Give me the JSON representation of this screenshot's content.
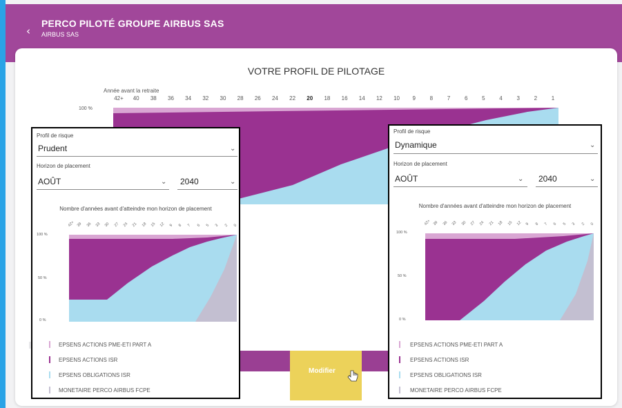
{
  "header": {
    "back_glyph": "‹",
    "title": "PERCO PILOTÉ GROUPE AIRBUS SAS",
    "subtitle": "AIRBUS SAS"
  },
  "card": {
    "title": "VOTRE PROFIL DE PILOTAGE",
    "axis_label": "Année avant la retraite",
    "ticks": [
      "42+",
      "40",
      "38",
      "36",
      "34",
      "32",
      "30",
      "28",
      "26",
      "24",
      "22",
      "20",
      "18",
      "16",
      "14",
      "12",
      "10",
      "9",
      "8",
      "7",
      "6",
      "5",
      "4",
      "3",
      "2",
      "1"
    ],
    "highlighted_tick": "20",
    "y_label_100": "100 %"
  },
  "colors": {
    "header": "#a1479a",
    "pme_eti": "#d9a6d3",
    "actions_isr": "#9a3291",
    "obligations_isr": "#a9dcef",
    "monetaire": "#c3bfd1",
    "highlight": "#ecd25a"
  },
  "modify_button": {
    "label": "Modifier"
  },
  "panels": [
    {
      "risk_label": "Profil de risque",
      "risk_value": "Prudent",
      "horizon_label": "Horizon de placement",
      "month_value": "AOÛT",
      "year_value": "2040",
      "chart_title": "Nombre d'années avant d'atteindre mon horizon de placement",
      "y_labels": [
        "100 %",
        "50 %",
        "0 %"
      ],
      "x_ticks": [
        "42+",
        "39",
        "36",
        "33",
        "30",
        "27",
        "24",
        "21",
        "18",
        "15",
        "12",
        "9",
        "8",
        "7",
        "6",
        "5",
        "3",
        "2",
        "0"
      ],
      "legend": [
        {
          "label": "EPSENS ACTIONS PME-ETI PART A",
          "color": "#d9a6d3"
        },
        {
          "label": "EPSENS ACTIONS ISR",
          "color": "#9a3291"
        },
        {
          "label": "EPSENS OBLIGATIONS ISR",
          "color": "#a9dcef"
        },
        {
          "label": "MONETAIRE PERCO AIRBUS FCPE",
          "color": "#c3bfd1"
        }
      ]
    },
    {
      "risk_label": "Profil de risque",
      "risk_value": "Dynamique",
      "horizon_label": "Horizon de placement",
      "month_value": "AOÛT",
      "year_value": "2040",
      "chart_title": "Nombre d'années avant d'atteindre mon horizon de placement",
      "y_labels": [
        "100 %",
        "50 %",
        "0 %"
      ],
      "x_ticks": [
        "42+",
        "39",
        "36",
        "33",
        "30",
        "27",
        "24",
        "21",
        "18",
        "15",
        "12",
        "9",
        "8",
        "7",
        "6",
        "5",
        "3",
        "2",
        "0"
      ],
      "legend": [
        {
          "label": "EPSENS ACTIONS PME-ETI PART A",
          "color": "#d9a6d3"
        },
        {
          "label": "EPSENS ACTIONS ISR",
          "color": "#9a3291"
        },
        {
          "label": "EPSENS OBLIGATIONS ISR",
          "color": "#a9dcef"
        },
        {
          "label": "MONETAIRE PERCO AIRBUS FCPE",
          "color": "#c3bfd1"
        }
      ]
    }
  ]
}
